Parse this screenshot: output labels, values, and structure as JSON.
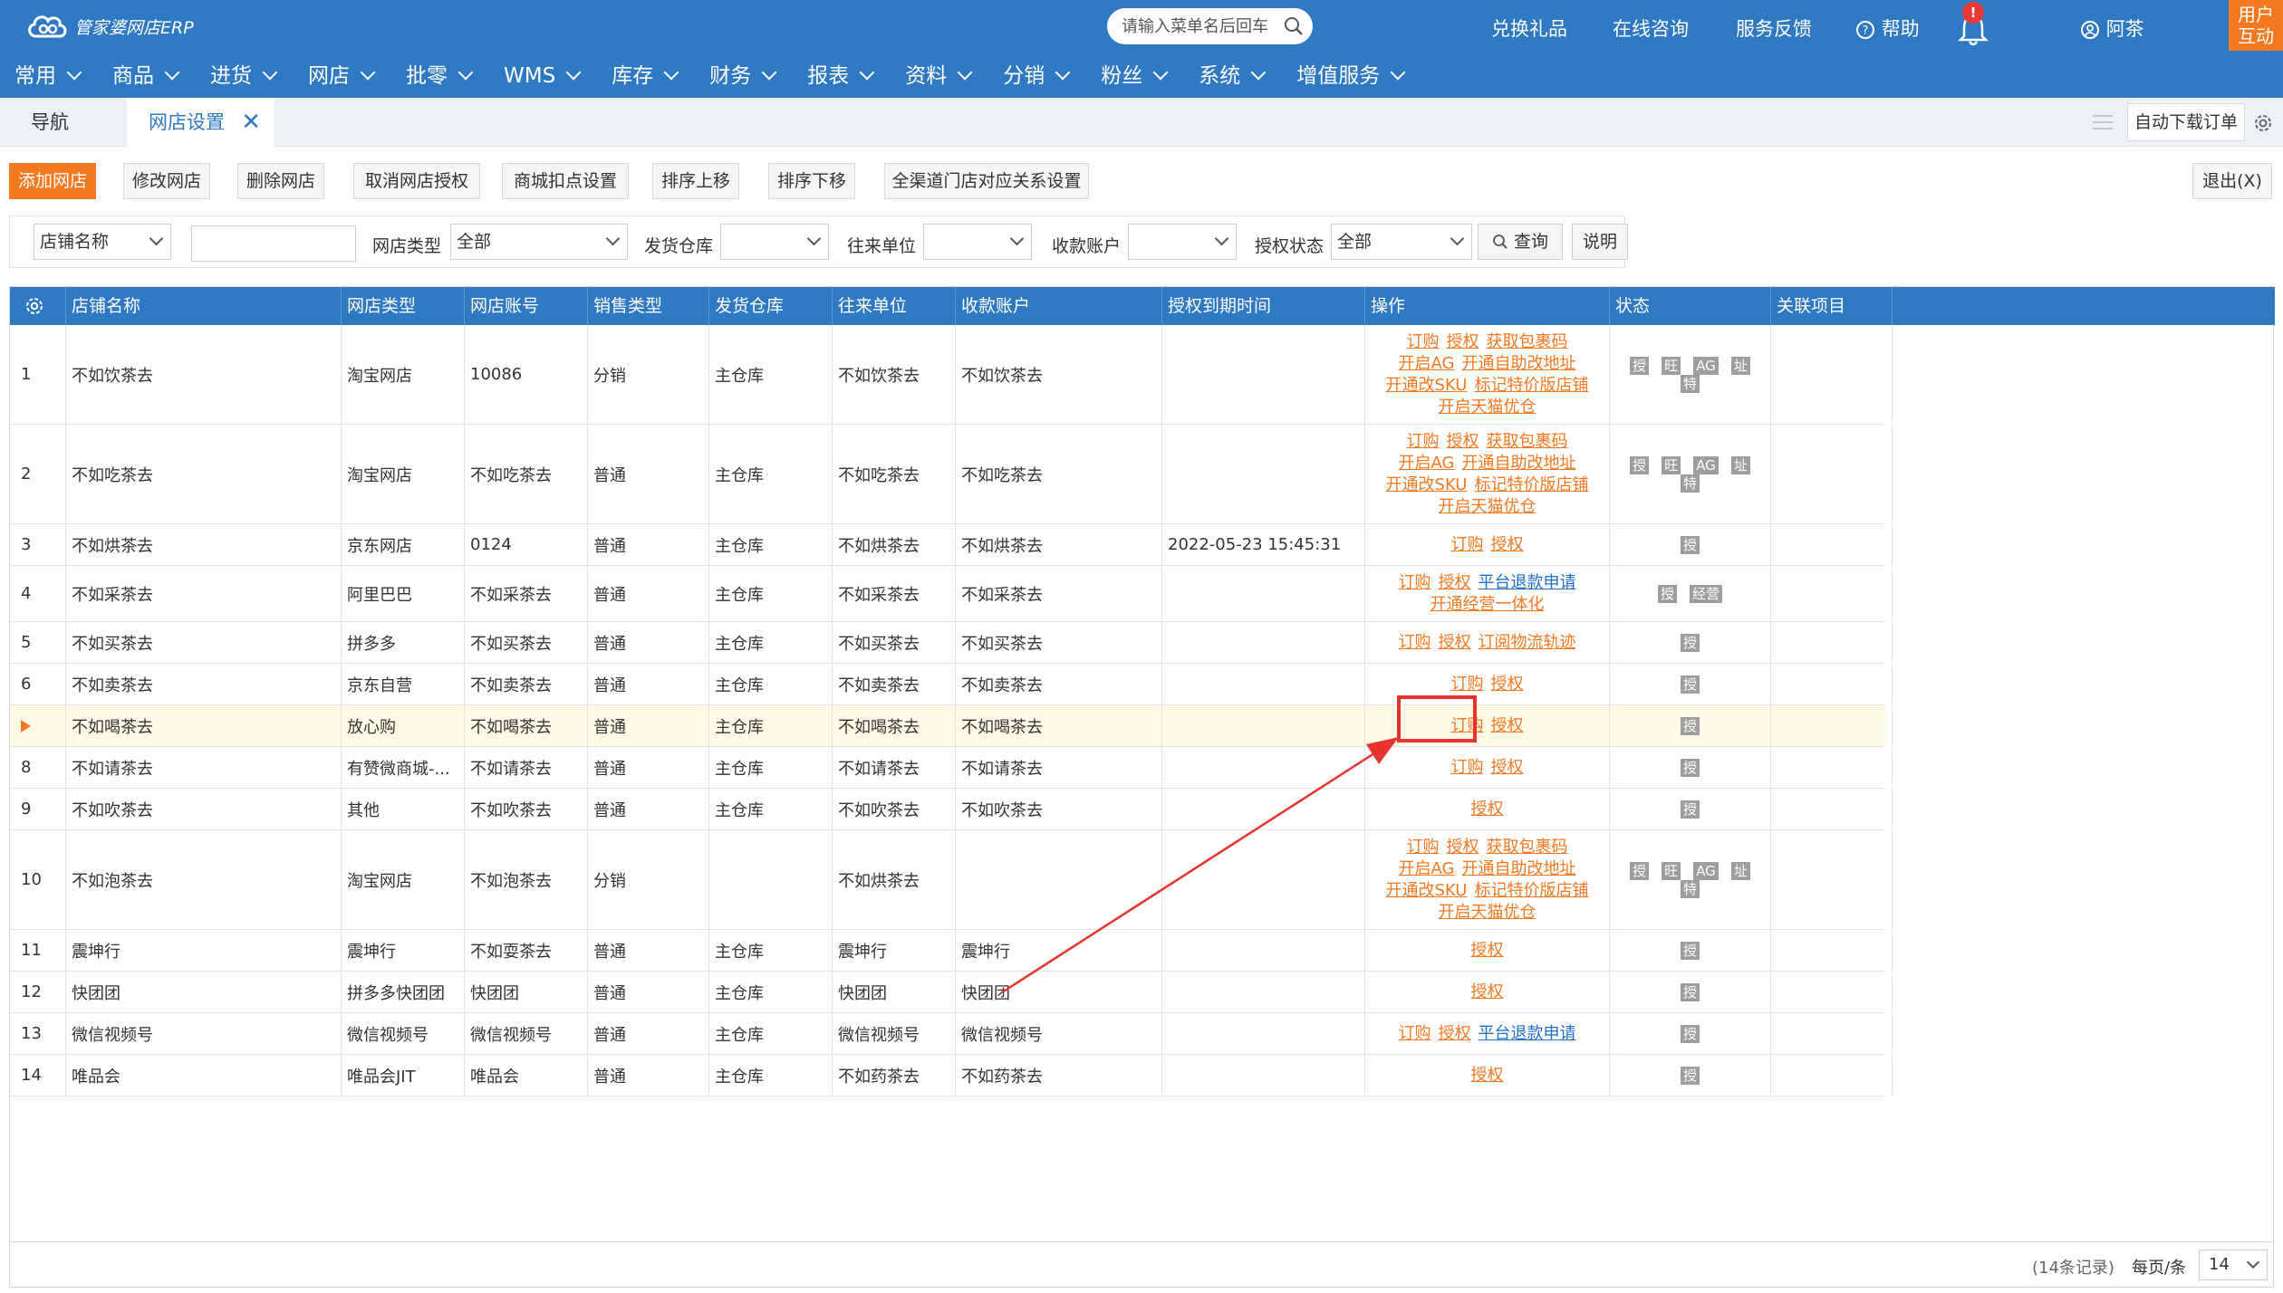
{
  "header": {
    "logo_text": "管家婆网店ERP",
    "search_placeholder": "请输入菜单名后回车",
    "links": [
      "兑换礼品",
      "在线咨询",
      "服务反馈",
      "帮助"
    ],
    "notification_count": "!",
    "user_name": "阿茶",
    "corner_button": [
      "用户",
      "互动"
    ]
  },
  "menu": [
    "常用",
    "商品",
    "进货",
    "网店",
    "批零",
    "WMS",
    "库存",
    "财务",
    "报表",
    "资料",
    "分销",
    "粉丝",
    "系统",
    "增值服务"
  ],
  "tabs": {
    "nav": "导航",
    "active": "网店设置",
    "close": "✕"
  },
  "auto_download": "自动下载订单",
  "toolbar": {
    "buttons": [
      "添加网店",
      "修改网店",
      "删除网店",
      "取消网店授权",
      "商城扣点设置",
      "排序上移",
      "排序下移",
      "全渠道门店对应关系设置"
    ],
    "exit": "退出(X)"
  },
  "filter": {
    "field_select": "店铺名称",
    "field_value": "",
    "shop_type_label": "网店类型",
    "shop_type_value": "全部",
    "warehouse_label": "发货仓库",
    "warehouse_value": "",
    "partner_label": "往来单位",
    "partner_value": "",
    "account_label": "收款账户",
    "account_value": "",
    "auth_label": "授权状态",
    "auth_value": "全部",
    "query_button": "查询",
    "help_button": "说明"
  },
  "columns": [
    "店铺名称",
    "网店类型",
    "网店账号",
    "销售类型",
    "发货仓库",
    "往来单位",
    "收款账户",
    "授权到期时间",
    "操作",
    "状态",
    "关联项目"
  ],
  "rows": [
    {
      "no": "1",
      "name": "不如饮茶去",
      "type": "淘宝网店",
      "account": "10086",
      "sale": "分销",
      "wh": "主仓库",
      "partner": "不如饮茶去",
      "pay": "不如饮茶去",
      "expire": "",
      "ops": [
        [
          [
            "订购",
            "o"
          ],
          [
            "授权",
            "o"
          ],
          [
            "获取包裹码",
            "o"
          ]
        ],
        [
          [
            "开启AG",
            "o"
          ],
          [
            "开通自助改地址",
            "o"
          ]
        ],
        [
          [
            "开通改SKU",
            "o"
          ],
          [
            "标记特价版店铺",
            "o"
          ]
        ],
        [
          [
            "开启天猫优仓",
            "o"
          ]
        ]
      ],
      "status": [
        [
          "授",
          "旺",
          "AG",
          "址"
        ],
        [
          "特"
        ]
      ]
    },
    {
      "no": "2",
      "name": "不如吃茶去",
      "type": "淘宝网店",
      "account": "不如吃茶去",
      "sale": "普通",
      "wh": "主仓库",
      "partner": "不如吃茶去",
      "pay": "不如吃茶去",
      "expire": "",
      "ops": [
        [
          [
            "订购",
            "o"
          ],
          [
            "授权",
            "o"
          ],
          [
            "获取包裹码",
            "o"
          ]
        ],
        [
          [
            "开启AG",
            "o"
          ],
          [
            "开通自助改地址",
            "o"
          ]
        ],
        [
          [
            "开通改SKU",
            "o"
          ],
          [
            "标记特价版店铺",
            "o"
          ]
        ],
        [
          [
            "开启天猫优仓",
            "o"
          ]
        ]
      ],
      "status": [
        [
          "授",
          "旺",
          "AG",
          "址"
        ],
        [
          "特"
        ]
      ]
    },
    {
      "no": "3",
      "name": "不如烘茶去",
      "type": "京东网店",
      "account": "0124",
      "sale": "普通",
      "wh": "主仓库",
      "partner": "不如烘茶去",
      "pay": "不如烘茶去",
      "expire": "2022-05-23 15:45:31",
      "ops": [
        [
          [
            "订购",
            "o"
          ],
          [
            "授权",
            "o"
          ]
        ]
      ],
      "status": [
        [
          "授"
        ]
      ]
    },
    {
      "no": "4",
      "name": "不如采茶去",
      "type": "阿里巴巴",
      "account": "不如采茶去",
      "sale": "普通",
      "wh": "主仓库",
      "partner": "不如采茶去",
      "pay": "不如采茶去",
      "expire": "",
      "ops": [
        [
          [
            "订购",
            "o"
          ],
          [
            "授权",
            "o"
          ],
          [
            "平台退款申请",
            "b"
          ]
        ],
        [
          [
            "开通经营一体化",
            "o"
          ]
        ]
      ],
      "status": [
        [
          "授",
          "经营"
        ]
      ]
    },
    {
      "no": "5",
      "name": "不如买茶去",
      "type": "拼多多",
      "account": "不如买茶去",
      "sale": "普通",
      "wh": "主仓库",
      "partner": "不如买茶去",
      "pay": "不如买茶去",
      "expire": "",
      "ops": [
        [
          [
            "订购",
            "o"
          ],
          [
            "授权",
            "o"
          ],
          [
            "订阅物流轨迹",
            "o"
          ]
        ]
      ],
      "status": [
        [
          "授"
        ]
      ]
    },
    {
      "no": "6",
      "name": "不如卖茶去",
      "type": "京东自营",
      "account": "不如卖茶去",
      "sale": "普通",
      "wh": "主仓库",
      "partner": "不如卖茶去",
      "pay": "不如卖茶去",
      "expire": "",
      "ops": [
        [
          [
            "订购",
            "o"
          ],
          [
            "授权",
            "o"
          ]
        ]
      ],
      "status": [
        [
          "授"
        ]
      ]
    },
    {
      "no": "",
      "name": "不如喝茶去",
      "type": "放心购",
      "account": "不如喝茶去",
      "sale": "普通",
      "wh": "主仓库",
      "partner": "不如喝茶去",
      "pay": "不如喝茶去",
      "expire": "",
      "ops": [
        [
          [
            "订购",
            "o"
          ],
          [
            "授权",
            "o"
          ]
        ]
      ],
      "status": [
        [
          "授"
        ]
      ]
    },
    {
      "no": "8",
      "name": "不如请茶去",
      "type": "有赞微商城-...",
      "account": "不如请茶去",
      "sale": "普通",
      "wh": "主仓库",
      "partner": "不如请茶去",
      "pay": "不如请茶去",
      "expire": "",
      "ops": [
        [
          [
            "订购",
            "o"
          ],
          [
            "授权",
            "o"
          ]
        ]
      ],
      "status": [
        [
          "授"
        ]
      ]
    },
    {
      "no": "9",
      "name": "不如吹茶去",
      "type": "其他",
      "account": "不如吹茶去",
      "sale": "普通",
      "wh": "主仓库",
      "partner": "不如吹茶去",
      "pay": "不如吹茶去",
      "expire": "",
      "ops": [
        [
          [
            "授权",
            "o"
          ]
        ]
      ],
      "status": [
        [
          "授"
        ]
      ]
    },
    {
      "no": "10",
      "name": "不如泡茶去",
      "type": "淘宝网店",
      "account": "不如泡茶去",
      "sale": "分销",
      "wh": "",
      "partner": "不如烘茶去",
      "pay": "",
      "expire": "",
      "ops": [
        [
          [
            "订购",
            "o"
          ],
          [
            "授权",
            "o"
          ],
          [
            "获取包裹码",
            "o"
          ]
        ],
        [
          [
            "开启AG",
            "o"
          ],
          [
            "开通自助改地址",
            "o"
          ]
        ],
        [
          [
            "开通改SKU",
            "o"
          ],
          [
            "标记特价版店铺",
            "o"
          ]
        ],
        [
          [
            "开启天猫优仓",
            "o"
          ]
        ]
      ],
      "status": [
        [
          "授",
          "旺",
          "AG",
          "址"
        ],
        [
          "特"
        ]
      ]
    },
    {
      "no": "11",
      "name": "震坤行",
      "type": "震坤行",
      "account": "不如耍茶去",
      "sale": "普通",
      "wh": "主仓库",
      "partner": "震坤行",
      "pay": "震坤行",
      "expire": "",
      "ops": [
        [
          [
            "授权",
            "o"
          ]
        ]
      ],
      "status": [
        [
          "授"
        ]
      ]
    },
    {
      "no": "12",
      "name": "快团团",
      "type": "拼多多快团团",
      "account": "快团团",
      "sale": "普通",
      "wh": "主仓库",
      "partner": "快团团",
      "pay": "快团团",
      "expire": "",
      "ops": [
        [
          [
            "授权",
            "o"
          ]
        ]
      ],
      "status": [
        [
          "授"
        ]
      ]
    },
    {
      "no": "13",
      "name": "微信视频号",
      "type": "微信视频号",
      "account": "微信视频号",
      "sale": "普通",
      "wh": "主仓库",
      "partner": "微信视频号",
      "pay": "微信视频号",
      "expire": "",
      "ops": [
        [
          [
            "订购",
            "o"
          ],
          [
            "授权",
            "o"
          ],
          [
            "平台退款申请",
            "b"
          ]
        ]
      ],
      "status": [
        [
          "授"
        ]
      ]
    },
    {
      "no": "14",
      "name": "唯品会",
      "type": "唯品会JIT",
      "account": "唯品会",
      "sale": "普通",
      "wh": "主仓库",
      "partner": "不如药茶去",
      "pay": "不如药茶去",
      "expire": "",
      "ops": [
        [
          [
            "授权",
            "o"
          ]
        ]
      ],
      "status": [
        [
          "授"
        ]
      ]
    }
  ],
  "pager": {
    "count": "(14条记录)",
    "per_page_label": "每页/条",
    "per_page_value": "14"
  },
  "colors": {
    "header_blue": "#2e79c1",
    "accent_orange": "#f47920",
    "annotation_red": "#e8322d",
    "selected_row": "#fffbe6"
  }
}
